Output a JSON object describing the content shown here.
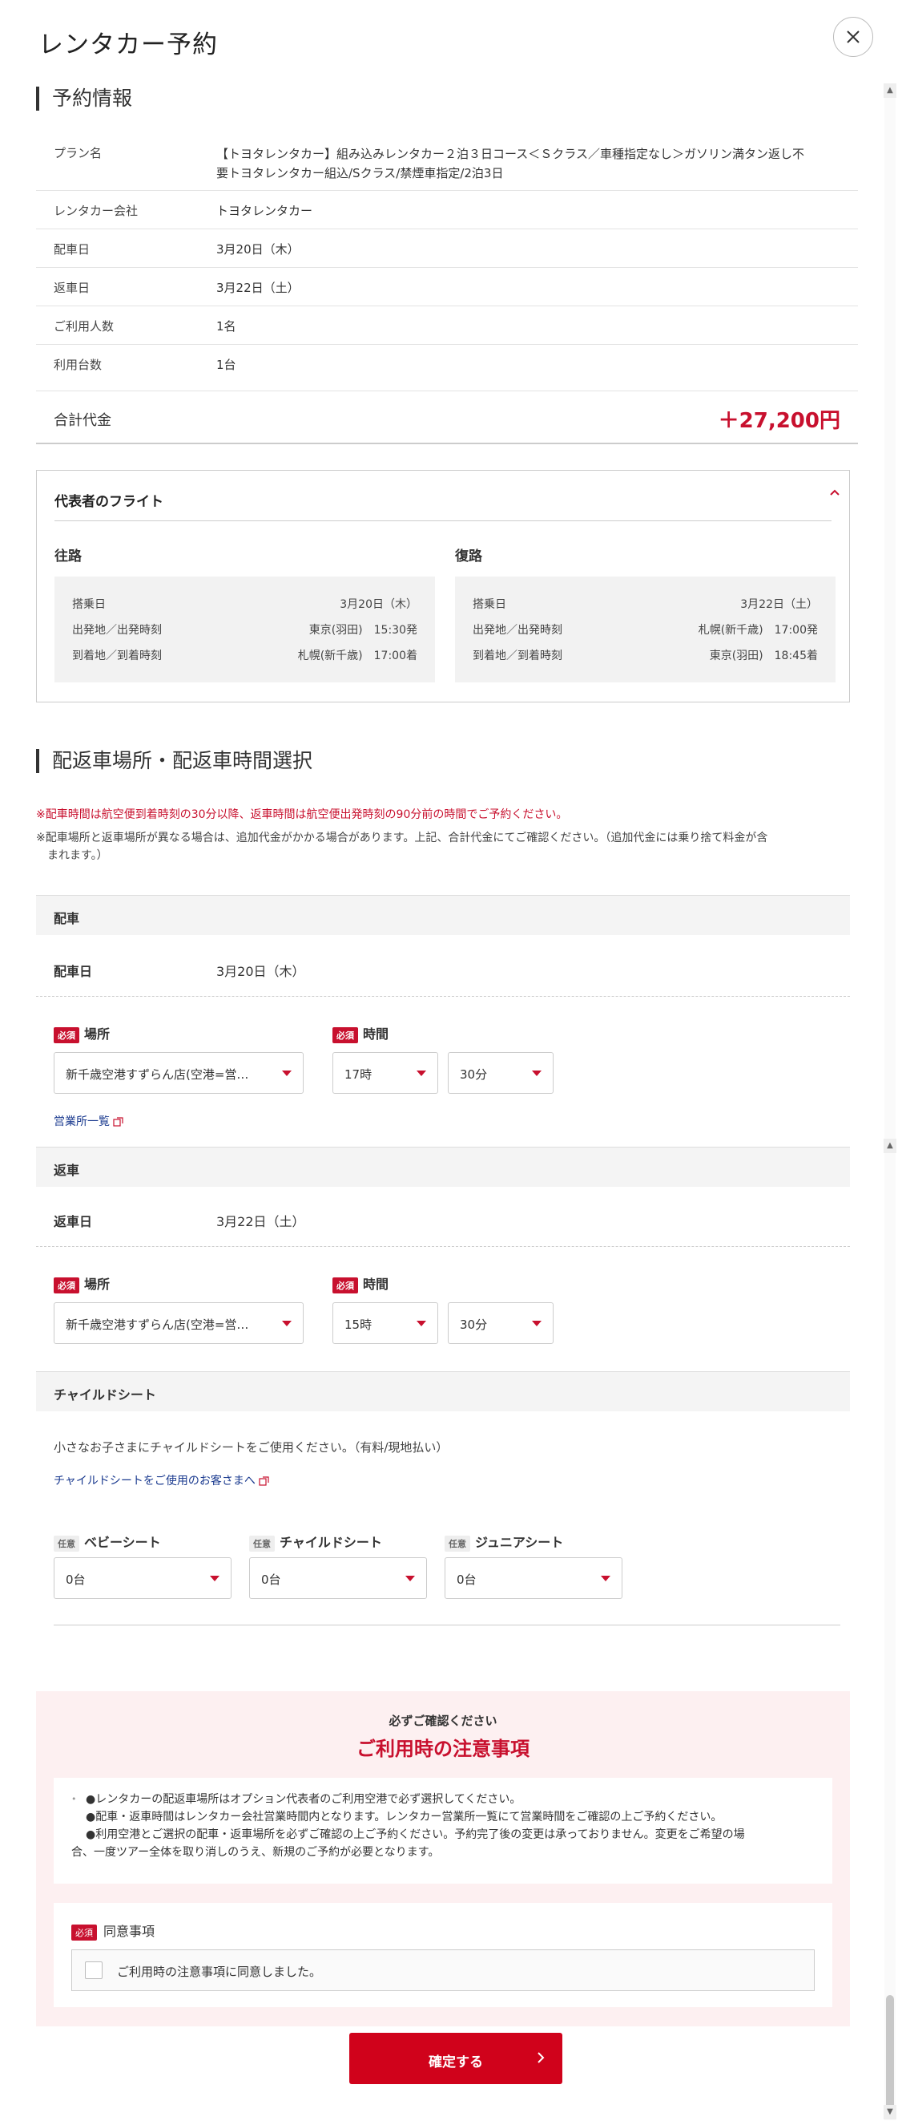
{
  "modal": {
    "title": "レンタカー予約"
  },
  "reservation": {
    "heading": "予約情報",
    "rows": [
      {
        "label": "プラン名",
        "value_line1": "【トヨタレンタカー】組み込みレンタカー２泊３日コース＜Ｓクラス／車種指定なし＞ガソリン満タン返し不",
        "value_line2": "要トヨタレンタカー組込/Sクラス/禁煙車指定/2泊3日"
      },
      {
        "label": "レンタカー会社",
        "value": "トヨタレンタカー"
      },
      {
        "label": "配車日",
        "value": "3月20日（木）"
      },
      {
        "label": "返車日",
        "value": "3月22日（土）"
      },
      {
        "label": "ご利用人数",
        "value": "1名"
      },
      {
        "label": "利用台数",
        "value": "1台"
      }
    ],
    "total_label": "合計代金",
    "total_value": "＋27,200円"
  },
  "flight": {
    "title": "代表者のフライト",
    "outbound": {
      "heading": "往路",
      "rows": [
        {
          "label": "搭乗日",
          "value": "3月20日（木）"
        },
        {
          "label": "出発地／出発時刻",
          "value": "東京(羽田)　15:30発"
        },
        {
          "label": "到着地／到着時刻",
          "value": "札幌(新千歳)　17:00着"
        }
      ]
    },
    "inbound": {
      "heading": "復路",
      "rows": [
        {
          "label": "搭乗日",
          "value": "3月22日（土）"
        },
        {
          "label": "出発地／出発時刻",
          "value": "札幌(新千歳)　17:00発"
        },
        {
          "label": "到着地／到着時刻",
          "value": "東京(羽田)　18:45着"
        }
      ]
    }
  },
  "pickup_section": {
    "heading": "配返車場所・配返車時間選択",
    "note_red": "※配車時間は航空便到着時刻の30分以降、返車時間は航空便出発時刻の90分前の時間でご予約ください。",
    "note_line1": "※配車場所と返車場所が異なる場合は、追加代金がかかる場合があります。上記、合計代金にてご確認ください。（追加代金には乗り捨て料金が含",
    "note_line2": "まれます。）",
    "required_badge": "必須",
    "optional_badge": "任意",
    "place_label": "場所",
    "time_label": "時間",
    "pickup": {
      "band": "配車",
      "date_label": "配車日",
      "date_value": "3月20日（木）",
      "place_value": "新千歳空港すずらん店(空港=営…",
      "hour_value": "17時",
      "minute_value": "30分",
      "office_link": "営業所一覧"
    },
    "return": {
      "band": "返車",
      "date_label": "返車日",
      "date_value": "3月22日（土）",
      "place_value": "新千歳空港すずらん店(空港=営…",
      "hour_value": "15時",
      "minute_value": "30分"
    }
  },
  "child_seat": {
    "band": "チャイルドシート",
    "description": "小さなお子さまにチャイルドシートをご使用ください。（有料/現地払い）",
    "link": "チャイルドシートをご使用のお客さまへ",
    "baby": {
      "label": "ベビーシート",
      "value": "0台"
    },
    "child": {
      "label": "チャイルドシート",
      "value": "0台"
    },
    "junior": {
      "label": "ジュニアシート",
      "value": "0台"
    }
  },
  "caution": {
    "subtitle": "必ずご確認ください",
    "title": "ご利用時の注意事項",
    "items": [
      "●レンタカーの配返車場所はオプション代表者のご利用空港で必ず選択してください。",
      "●配車・返車時間はレンタカー会社営業時間内となります。レンタカー営業所一覧にて営業時間をご確認の上ご予約ください。",
      "●利用空港とご選択の配車・返車場所を必ずご確認の上ご予約ください。予約完了後の変更は承っておりません。変更をご希望の場",
      "合、一度ツアー全体を取り消しのうえ、新規のご予約が必要となります。"
    ],
    "agree_label": "同意事項",
    "agree_text": "ご利用時の注意事項に同意しました。"
  },
  "confirm_button": "確定する",
  "colors": {
    "accent": "#c8102e",
    "button": "#d0021b",
    "caution_bg": "#fdf0f1",
    "link": "#1a3a8f"
  }
}
